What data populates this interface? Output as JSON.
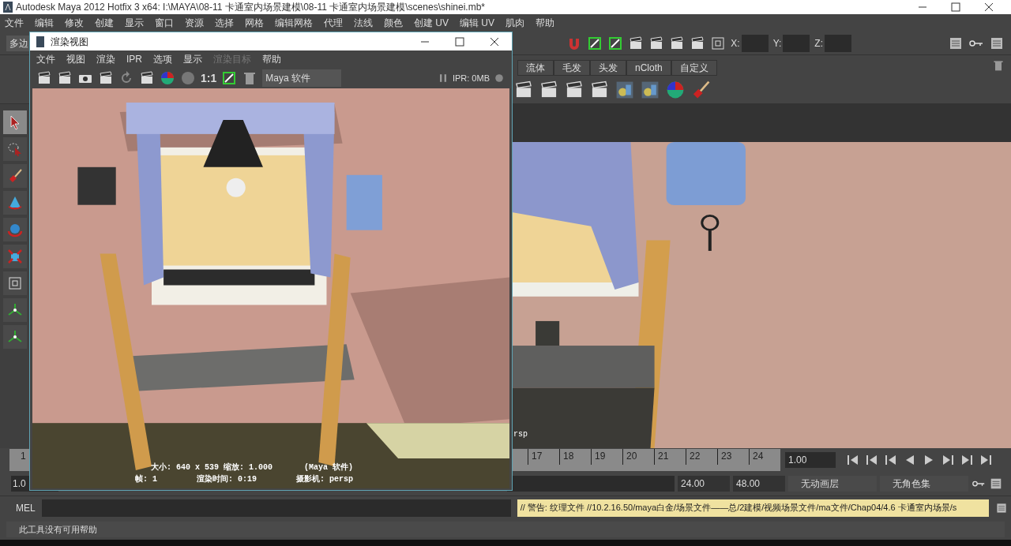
{
  "window": {
    "title": "Autodesk Maya 2012 Hotfix 3 x64: I:\\MAYA\\08-11 卡通室内场景建模\\08-11 卡通室内场景建模\\scenes\\shinei.mb*"
  },
  "menu": [
    "文件",
    "编辑",
    "修改",
    "创建",
    "显示",
    "窗口",
    "资源",
    "选择",
    "网格",
    "编辑网格",
    "代理",
    "法线",
    "颜色",
    "创建 UV",
    "编辑 UV",
    "肌肉",
    "帮助"
  ],
  "status_line": {
    "mode_menu": "多边",
    "coord_labels": [
      "X:",
      "Y:",
      "Z:"
    ]
  },
  "shelf": {
    "tabs": [
      "流体",
      "毛发",
      "头发",
      "nCloth",
      "自定义"
    ]
  },
  "toolbox": [
    {
      "selected": true
    },
    {
      "selected": false
    },
    {
      "selected": false
    },
    {
      "selected": false
    },
    {
      "selected": false
    },
    {
      "selected": false
    },
    {
      "selected": false
    },
    {
      "selected": false
    },
    {
      "selected": false
    }
  ],
  "viewport": {
    "camera_label": "rsp"
  },
  "timeline": {
    "labels": [
      "1",
      "17",
      "18",
      "19",
      "20",
      "21",
      "22",
      "23",
      "24"
    ],
    "current_frame": "1.00"
  },
  "range": {
    "start": "1.0",
    "end": "24.00",
    "max": "48.00",
    "anim_layer": "无动画层",
    "character_set": "无角色集"
  },
  "command_line": {
    "label": "MEL",
    "result": "// 警告: 纹理文件 //10.2.16.50/maya白金/场景文件——总/2建模/视频场景文件/ma文件/Chap04/4.6 卡通室内场景/s"
  },
  "help_line": "此工具没有可用帮助",
  "render_view": {
    "title": "渲染视图",
    "menu": [
      {
        "label": "文件",
        "disabled": false
      },
      {
        "label": "视图",
        "disabled": false
      },
      {
        "label": "渲染",
        "disabled": false
      },
      {
        "label": "IPR",
        "disabled": false
      },
      {
        "label": "选项",
        "disabled": false
      },
      {
        "label": "显示",
        "disabled": false
      },
      {
        "label": "渲染目标",
        "disabled": true
      },
      {
        "label": "帮助",
        "disabled": false
      }
    ],
    "zoom_label": "1:1",
    "renderer": "Maya 软件",
    "ipr": "IPR: 0MB",
    "info": [
      [
        "大小: 640 x 539 缩放: 1.000",
        "(Maya 软件)"
      ],
      [
        "帧: 1",
        "渲染时间: 0:19",
        "摄影机: persp"
      ]
    ]
  }
}
